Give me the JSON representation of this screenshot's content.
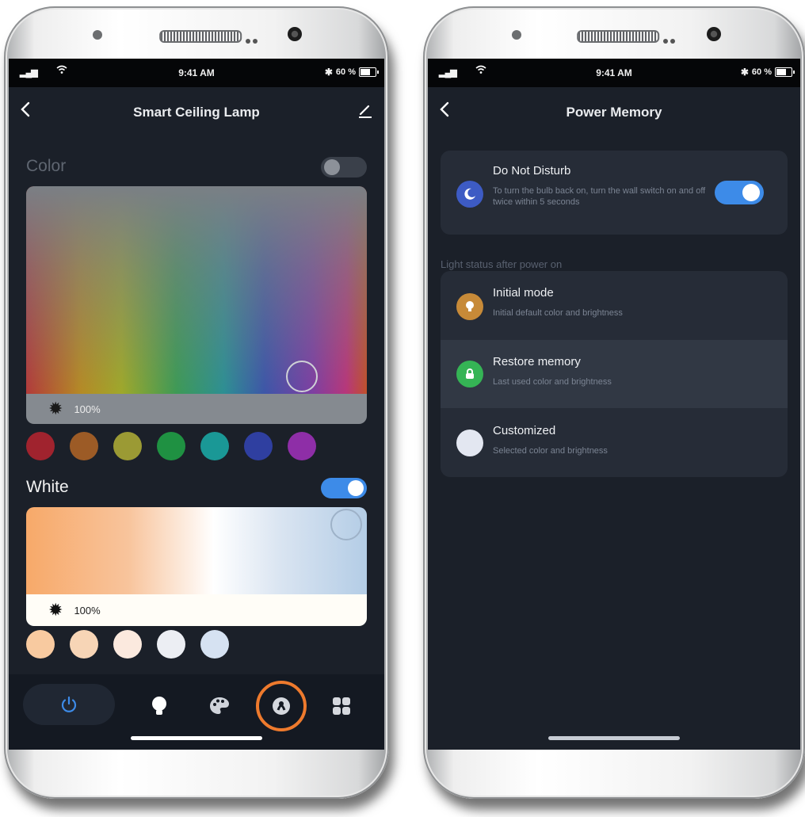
{
  "status_bar": {
    "time": "9:41 AM",
    "battery": "60 %",
    "battery_level": 0.6
  },
  "left_screen": {
    "nav": {
      "back_icon": "chevron-left-icon",
      "title": "Smart Ceiling Lamp",
      "edit_icon": "pencil-icon"
    },
    "color_section": {
      "label": "Color",
      "toggle_on": false,
      "brightness": "100%",
      "swatches": [
        "#a0232e",
        "#9c5b26",
        "#9b9a34",
        "#1f9142",
        "#1a9896",
        "#2f3fa0",
        "#8e2ea7"
      ]
    },
    "white_section": {
      "label": "White",
      "toggle_on": true,
      "brightness": "100%",
      "swatches": [
        "#f8caa0",
        "#f7d5b6",
        "#fbe9de",
        "#eceef3",
        "#d6e2f2"
      ]
    },
    "tab_bar": {
      "tabs": [
        {
          "name": "power",
          "icon": "power-icon"
        },
        {
          "name": "white",
          "icon": "bulb-icon"
        },
        {
          "name": "color",
          "icon": "palette-icon"
        },
        {
          "name": "scene",
          "icon": "scene-icon",
          "highlighted": true
        },
        {
          "name": "more",
          "icon": "grid-icon"
        }
      ],
      "highlight_color": "#ee7a2d"
    }
  },
  "right_screen": {
    "nav": {
      "back_icon": "chevron-left-icon",
      "title": "Power Memory"
    },
    "do_not_disturb": {
      "title": "Do Not Disturb",
      "description": "To turn the bulb back on, turn the wall switch on and off twice within 5 seconds",
      "toggle_on": true,
      "icon": "moon-icon",
      "icon_color": "#3d5bc4"
    },
    "section_caption": "Light status after power on",
    "options": [
      {
        "title": "Initial mode",
        "subtitle": "Initial default color and brightness",
        "icon": "bulb-icon",
        "icon_color": "#c78a38",
        "selected": false
      },
      {
        "title": "Restore memory",
        "subtitle": "Last used color and brightness",
        "icon": "lock-icon",
        "icon_color": "#35b455",
        "selected": true
      },
      {
        "title": "Customized",
        "subtitle": "Selected color and brightness",
        "icon": "circle-icon",
        "icon_color": "#e3e7f1",
        "selected": false
      }
    ]
  },
  "colors": {
    "accent_blue": "#3d8be8",
    "screen_bg": "#1b2029",
    "card_bg": "#262c37"
  }
}
